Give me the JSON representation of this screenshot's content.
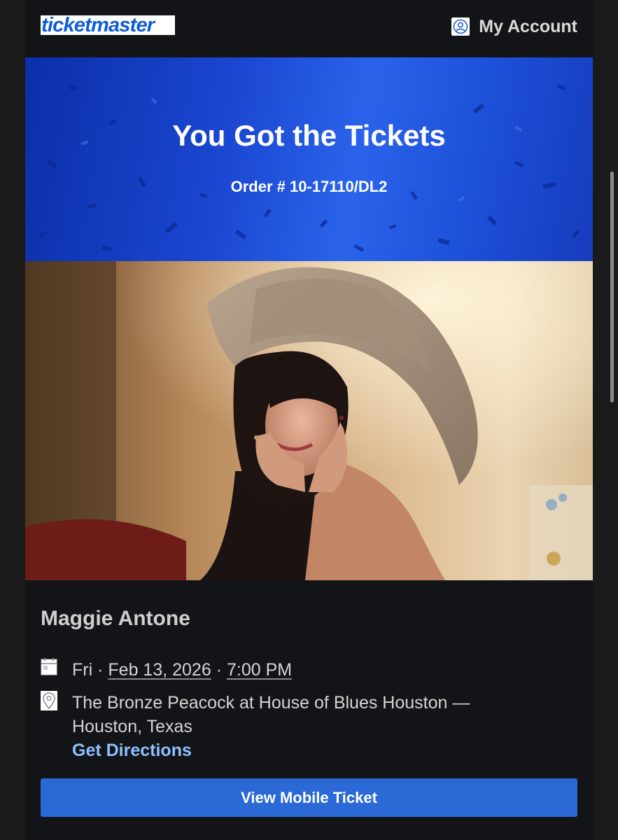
{
  "header": {
    "logo_text": "ticketmaster",
    "account_label": "My Account",
    "account_icon": "user-circle-icon"
  },
  "hero": {
    "title": "You Got the Tickets",
    "order": "Order # 10-17110/DL2"
  },
  "photo": {
    "subject": "artist-photo"
  },
  "event": {
    "artist": "Maggie Antone",
    "day": "Fri",
    "separator": "·",
    "date": "Feb 13, 2026",
    "time": "7:00 PM",
    "venue": "The Bronze Peacock at House of Blues Houston — Houston, Texas",
    "directions_label": "Get Directions",
    "calendar_icon": "calendar-icon",
    "location_icon": "location-pin-icon"
  },
  "cta": {
    "label": "View Mobile Ticket"
  },
  "colors": {
    "brand_blue": "#0f5dd6",
    "hero_blue": "#1a46d0",
    "button_blue": "#2a69d6",
    "link_blue": "#8fc0ff",
    "background": "#121417"
  }
}
